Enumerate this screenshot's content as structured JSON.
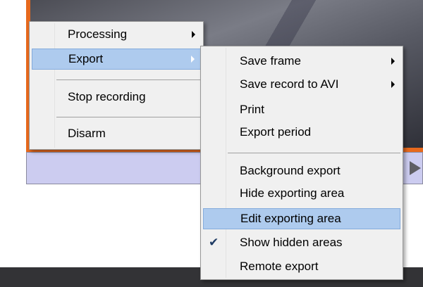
{
  "main_menu": {
    "items": [
      {
        "label": "Processing",
        "has_submenu": true
      },
      {
        "label": "Export",
        "has_submenu": true,
        "highlighted": true
      },
      {
        "label": "Stop recording"
      },
      {
        "label": "Disarm"
      }
    ]
  },
  "export_submenu": {
    "items": [
      {
        "label": "Save frame",
        "has_submenu": true
      },
      {
        "label": "Save record to AVI",
        "has_submenu": true
      },
      {
        "label": "Print"
      },
      {
        "label": "Export period"
      },
      {
        "label": "Background export"
      },
      {
        "label": "Hide exporting area"
      },
      {
        "label": "Edit exporting area",
        "highlighted": true
      },
      {
        "label": "Show hidden areas",
        "checked": true
      },
      {
        "label": "Remote export"
      }
    ]
  },
  "colors": {
    "accent_orange": "#e7691d",
    "menu_background": "#f0f0f0",
    "hover_highlight": "#cce8ff",
    "control_bar": "#ccccf0"
  },
  "icons": {
    "submenu_arrow": "triangle-right",
    "check": "check-mark",
    "next_arrow": "play-triangle"
  }
}
